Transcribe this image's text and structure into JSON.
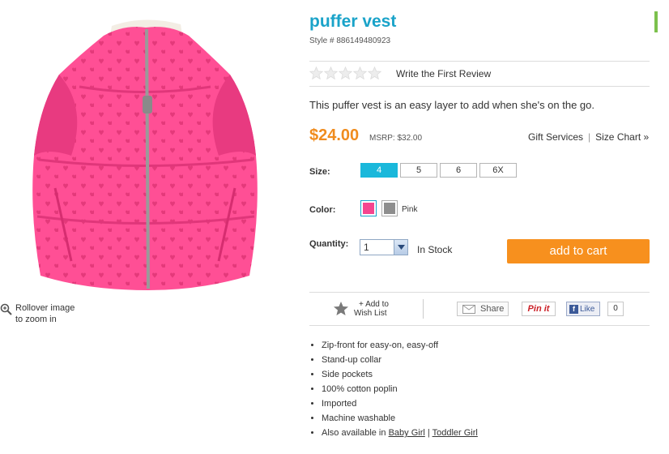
{
  "product": {
    "title": "puffer vest",
    "style": "Style # 886149480923",
    "review_link": "Write the First Review",
    "description": "This puffer vest is an easy layer to add when she's on the go.",
    "price": "$24.00",
    "msrp": "MSRP: $32.00",
    "rating": 0
  },
  "links": {
    "gift": "Gift Services",
    "size_chart": "Size Chart »"
  },
  "size": {
    "label": "Size:",
    "options": [
      "4",
      "5",
      "6",
      "6X"
    ],
    "selected": "4"
  },
  "color": {
    "label": "Color:",
    "name": "Pink",
    "swatches": [
      "#f5458f",
      "#8e8e8e"
    ]
  },
  "quantity": {
    "label": "Quantity:",
    "value": "1",
    "stock": "In Stock"
  },
  "cart": {
    "label": "add to cart"
  },
  "zoom": {
    "line1": "Rollover image",
    "line2": "to zoom in"
  },
  "share": {
    "wish_line1": "+ Add to",
    "wish_line2": "Wish List",
    "share": "Share",
    "pin": "Pin it",
    "like": "Like",
    "like_count": "0"
  },
  "features": [
    "Zip-front for easy-on, easy-off",
    "Stand-up collar",
    "Side pockets",
    "100% cotton poplin",
    "Imported",
    "Machine washable"
  ],
  "also": {
    "prefix": "Also available in ",
    "link1": "Baby Girl",
    "sep": " | ",
    "link2": "Toddler Girl"
  },
  "colors": {
    "accent": "#1aa3c9",
    "price": "#f08c1e",
    "cart": "#f7901e"
  }
}
